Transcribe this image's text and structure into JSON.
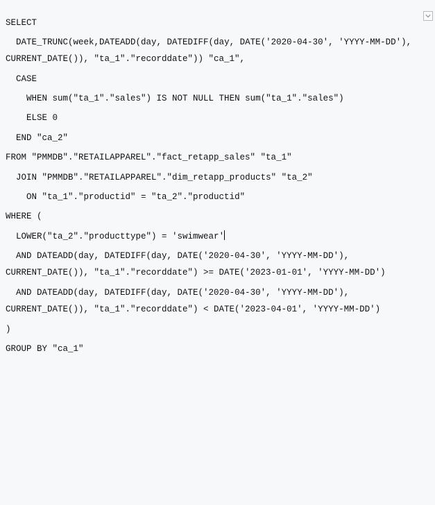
{
  "code": {
    "lines": [
      "SELECT",
      "",
      "  DATE_TRUNC(week,DATEADD(day, DATEDIFF(day, DATE('2020-04-30', 'YYYY-MM-DD'), CURRENT_DATE()), \"ta_1\".\"recorddate\")) \"ca_1\",",
      "",
      "  CASE",
      "",
      "    WHEN sum(\"ta_1\".\"sales\") IS NOT NULL THEN sum(\"ta_1\".\"sales\")",
      "",
      "    ELSE 0",
      "",
      "  END \"ca_2\"",
      "",
      "FROM \"PMMDB\".\"RETAILAPPAREL\".\"fact_retapp_sales\" \"ta_1\"",
      "",
      "  JOIN \"PMMDB\".\"RETAILAPPAREL\".\"dim_retapp_products\" \"ta_2\"",
      "",
      "    ON \"ta_1\".\"productid\" = \"ta_2\".\"productid\"",
      "",
      "WHERE (",
      "",
      "  LOWER(\"ta_2\".\"producttype\") = 'swimwear'",
      "",
      "  AND DATEADD(day, DATEDIFF(day, DATE('2020-04-30', 'YYYY-MM-DD'), CURRENT_DATE()), \"ta_1\".\"recorddate\") >= DATE('2023-01-01', 'YYYY-MM-DD')",
      "",
      "  AND DATEADD(day, DATEDIFF(day, DATE('2020-04-30', 'YYYY-MM-DD'), CURRENT_DATE()), \"ta_1\".\"recorddate\") < DATE('2023-04-01', 'YYYY-MM-DD')",
      "",
      ")",
      "",
      "GROUP BY \"ca_1\""
    ],
    "cursor_line_index": 20
  },
  "corner_icon": "expand-icon"
}
